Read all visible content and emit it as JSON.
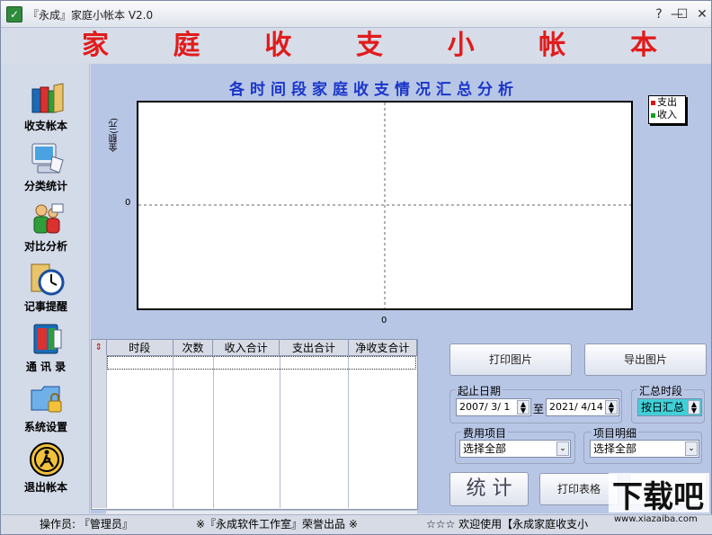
{
  "window": {
    "title": "『永成』家庭小帐本 V2.0",
    "minimize_glyph": "—",
    "maximize_glyph": "☐",
    "close_glyph": "✕",
    "help_glyph": "?"
  },
  "banner": {
    "chars": [
      "家",
      "庭",
      "收",
      "支",
      "小",
      "帐",
      "本"
    ]
  },
  "sidebar": {
    "items": [
      {
        "label": "收支帐本",
        "icon": "books-icon"
      },
      {
        "label": "分类统计",
        "icon": "computer-icon"
      },
      {
        "label": "对比分析",
        "icon": "people-icon"
      },
      {
        "label": "记事提醒",
        "icon": "clock-icon"
      },
      {
        "label": "通 讯 录",
        "icon": "address-book-icon"
      },
      {
        "label": "系统设置",
        "icon": "folder-lock-icon"
      },
      {
        "label": "退出帐本",
        "icon": "exit-icon"
      }
    ]
  },
  "chart": {
    "title": "各时间段家庭收支情况汇总分析",
    "ylabel": "金额(元)",
    "y_tick": "0",
    "x_tick": "0",
    "legend": [
      {
        "label": "支出",
        "color": "#e01010"
      },
      {
        "label": "收入",
        "color": "#10a020"
      }
    ]
  },
  "chart_data": {
    "type": "bar",
    "title": "各时间段家庭收支情况汇总分析",
    "xlabel": "",
    "ylabel": "金额(元)",
    "categories": [],
    "series": [
      {
        "name": "支出",
        "values": []
      },
      {
        "name": "收入",
        "values": []
      }
    ],
    "x_ticks": [
      "0"
    ],
    "y_ticks": [
      "0"
    ],
    "grid": true,
    "legend_position": "top-right"
  },
  "table": {
    "columns": [
      "时段",
      "次数",
      "收入合计",
      "支出合计",
      "净收支合计"
    ],
    "rows": []
  },
  "controls": {
    "print_image": "打印图片",
    "export_image": "导出图片",
    "start_date_label": "起止日期",
    "start_date": "2007/  3/  1",
    "to_label": "至",
    "end_date": "2021/  4/14",
    "period_label": "汇总时段",
    "period_value": "按日汇总",
    "expense_label": "费用项目",
    "expense_value": "选择全部",
    "detail_label": "项目明细",
    "detail_value": "选择全部",
    "stat_button": "统 计",
    "print_table": "打印表格"
  },
  "statusbar": {
    "operator": "操作员: 『管理员』",
    "credit": "※『永成软件工作室』荣誉出品 ※",
    "welcome": "☆☆☆  欢迎使用【永成家庭收支小"
  },
  "colors": {
    "banner_red": "#e21b1b",
    "chart_title_blue": "#1a36c9",
    "panel_blue": "#b8c6e6"
  }
}
